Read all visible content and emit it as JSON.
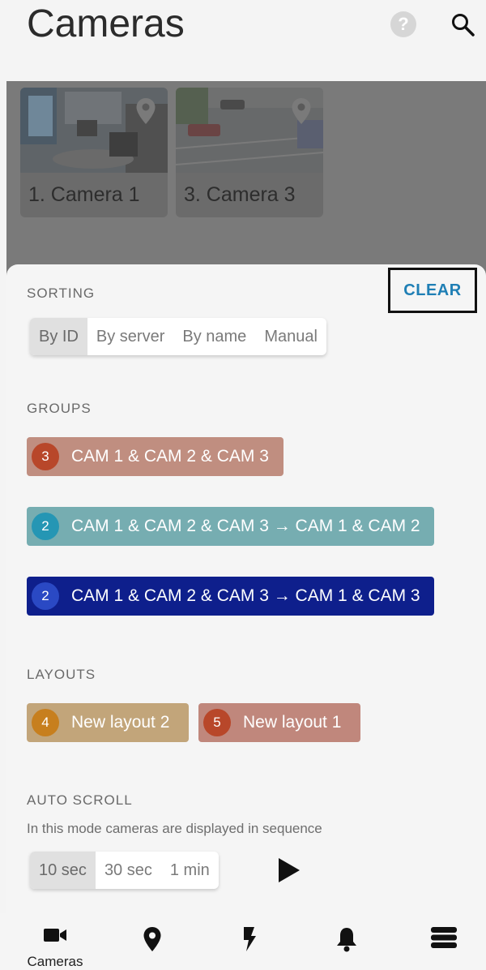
{
  "header": {
    "title": "Cameras",
    "help_icon": "?"
  },
  "cameras": [
    {
      "label": "1. Camera 1"
    },
    {
      "label": "3. Camera 3"
    }
  ],
  "sorting": {
    "title": "SORTING",
    "clear_label": "CLEAR",
    "options": [
      "By ID",
      "By server",
      "By name",
      "Manual"
    ],
    "selected": "By ID"
  },
  "groups": {
    "title": "GROUPS",
    "items": [
      {
        "count": "3",
        "label": "CAM 1 & CAM 2 & CAM 3",
        "color": "#c08e80",
        "badge_color": "#b8472a"
      },
      {
        "count": "2",
        "label": "CAM 1 & CAM 2 & CAM 3 → CAM 1 & CAM 2",
        "color": "#76adb1",
        "badge_color": "#2596b4"
      },
      {
        "count": "2",
        "label": "CAM 1 & CAM 2 & CAM 3 → CAM 1 & CAM 3",
        "color": "#0e1f8c",
        "badge_color": "#2a49c4"
      }
    ]
  },
  "layouts": {
    "title": "LAYOUTS",
    "items": [
      {
        "count": "4",
        "label": "New layout 2",
        "color": "#c2a57a",
        "badge_color": "#c77f1e"
      },
      {
        "count": "5",
        "label": "New layout 1",
        "color": "#c0877c",
        "badge_color": "#b8472a"
      }
    ]
  },
  "auto_scroll": {
    "title": "AUTO SCROLL",
    "description": "In this mode cameras are displayed in sequence",
    "options": [
      "10 sec",
      "30 sec",
      "1 min"
    ],
    "selected": "10 sec"
  },
  "bottom_nav": {
    "items": [
      {
        "label": "Cameras",
        "icon": "video-camera-icon"
      },
      {
        "label": "",
        "icon": "map-pin-icon"
      },
      {
        "label": "",
        "icon": "lightning-icon"
      },
      {
        "label": "",
        "icon": "bell-icon"
      },
      {
        "label": "",
        "icon": "menu-stack-icon"
      }
    ]
  }
}
